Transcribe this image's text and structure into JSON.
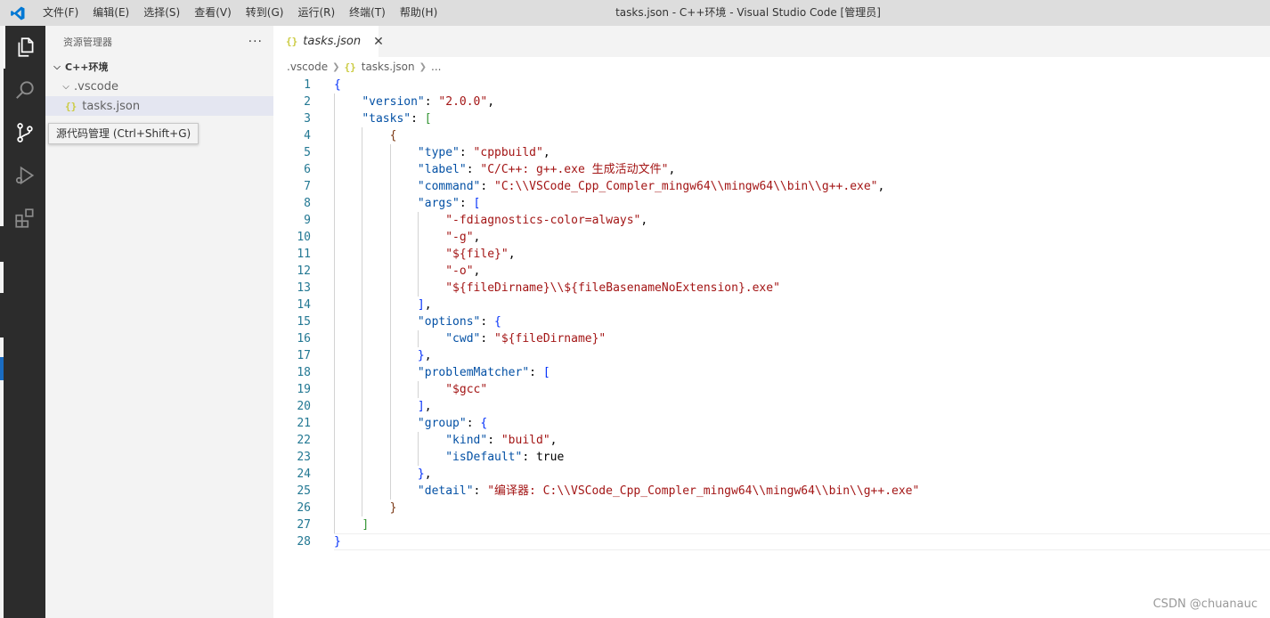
{
  "titlebar": {
    "menu": [
      "文件(F)",
      "编辑(E)",
      "选择(S)",
      "查看(V)",
      "转到(G)",
      "运行(R)",
      "终端(T)",
      "帮助(H)"
    ],
    "window_title": "tasks.json - C++环境 - Visual Studio Code [管理员]"
  },
  "activitybar": {
    "items": [
      "explorer-icon",
      "search-icon",
      "source-control-icon",
      "run-debug-icon",
      "extensions-icon"
    ],
    "tooltip": "源代码管理 (Ctrl+Shift+G)"
  },
  "sidebar": {
    "title": "资源管理器",
    "more": "···",
    "root": "C++环境",
    "folder": ".vscode",
    "file": "tasks.json"
  },
  "editor": {
    "tab_label": "tasks.json",
    "breadcrumb": [
      ".vscode",
      "tasks.json",
      "..."
    ],
    "lines": [
      "{",
      "    \"version\": \"2.0.0\",",
      "    \"tasks\": [",
      "        {",
      "            \"type\": \"cppbuild\",",
      "            \"label\": \"C/C++: g++.exe 生成活动文件\",",
      "            \"command\": \"C:\\\\VSCode_Cpp_Compler_mingw64\\\\mingw64\\\\bin\\\\g++.exe\",",
      "            \"args\": [",
      "                \"-fdiagnostics-color=always\",",
      "                \"-g\",",
      "                \"${file}\",",
      "                \"-o\",",
      "                \"${fileDirname}\\\\${fileBasenameNoExtension}.exe\"",
      "            ],",
      "            \"options\": {",
      "                \"cwd\": \"${fileDirname}\"",
      "            },",
      "            \"problemMatcher\": [",
      "                \"$gcc\"",
      "            ],",
      "            \"group\": {",
      "                \"kind\": \"build\",",
      "                \"isDefault\": true",
      "            },",
      "            \"detail\": \"编译器: C:\\\\VSCode_Cpp_Compler_mingw64\\\\mingw64\\\\bin\\\\g++.exe\"",
      "        }",
      "    ]",
      "}"
    ],
    "current_line": 28
  },
  "watermark": "CSDN @chuanauc"
}
